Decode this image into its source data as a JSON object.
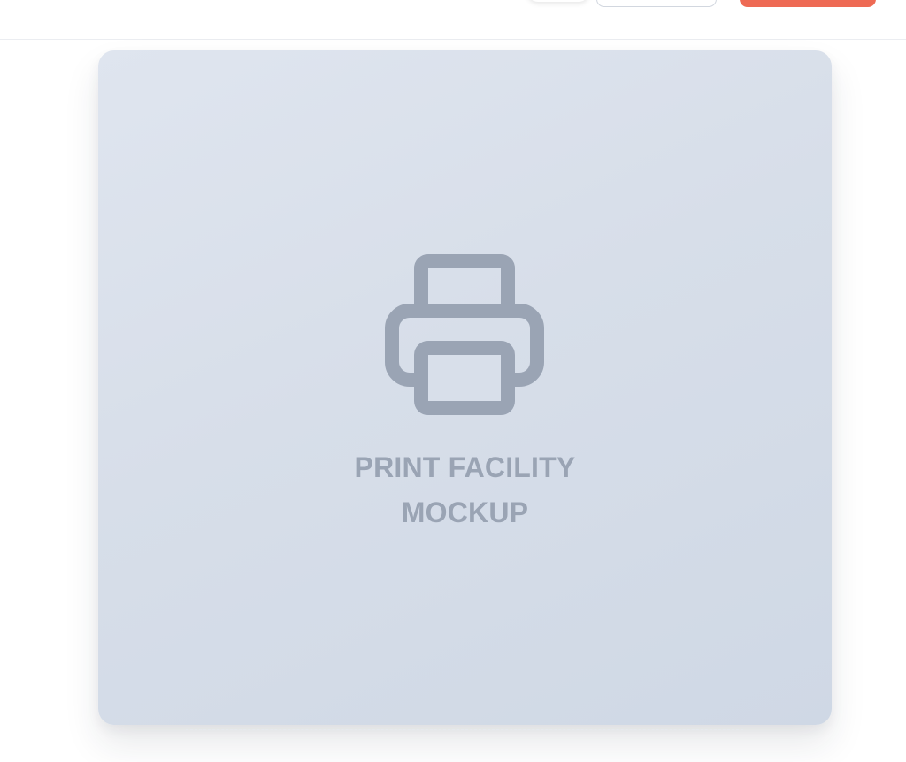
{
  "header": {
    "secondary_button_label": "",
    "primary_button_label": "",
    "primary_color": "#ee6a54"
  },
  "card": {
    "icon": "printer-icon",
    "caption_line1": "PRINT FACILITY",
    "caption_line2": "MOCKUP",
    "caption_color": "#9aa4b4"
  }
}
